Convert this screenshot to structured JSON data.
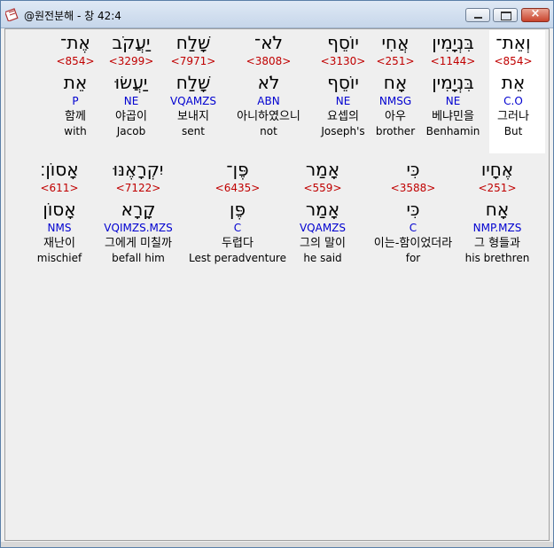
{
  "window": {
    "title": "@원전분해 - 창 42:4",
    "app_icon": "book-icon",
    "close_glyph": "×"
  },
  "rows": [
    [
      {
        "heb": "וְאֵת־",
        "num": "<854>",
        "lemma": "אֵת",
        "parse": "C.O",
        "kor": "그러나",
        "eng": "But",
        "selected": true
      },
      {
        "heb": "בִּנְיָמִין",
        "num": "<1144>",
        "lemma": "בִּנְיָמִין",
        "parse": "NE",
        "kor": "베냐민을",
        "eng": "Benhamin"
      },
      {
        "heb": "אֲחִי",
        "num": "<251>",
        "lemma": "אָח",
        "parse": "NMSG",
        "kor": "아우",
        "eng": "brother"
      },
      {
        "heb": "יוֹסֵף",
        "num": "<3130>",
        "lemma": "יוֹסֵף",
        "parse": "NE",
        "kor": "요셉의",
        "eng": "Joseph's"
      },
      {
        "heb": "לֹא־",
        "num": "<3808>",
        "lemma": "לֹא",
        "parse": "ABN",
        "kor": "아니하였으니",
        "eng": "not"
      },
      {
        "heb": "שָׁלַח",
        "num": "<7971>",
        "lemma": "שָׁלַח",
        "parse": "VQAMZS",
        "kor": "보내지",
        "eng": "sent"
      },
      {
        "heb": "יַעֲקֹב",
        "num": "<3299>",
        "lemma": "יַעֲשׂוּ",
        "parse": "NE",
        "kor": "야곱이",
        "eng": "Jacob"
      },
      {
        "heb": "אֶת־",
        "num": "<854>",
        "lemma": "אֵת",
        "parse": "P",
        "kor": "함께",
        "eng": "with"
      }
    ],
    [
      {
        "heb": "אֶחָיו",
        "num": "<251>",
        "lemma": "אָח",
        "parse": "NMP.MZS",
        "kor": "그 형들과",
        "eng": "his brethren"
      },
      {
        "heb": "כִּי",
        "num": "<3588>",
        "lemma": "כִּי",
        "parse": "C",
        "kor": "이는-함이었더라",
        "eng": "for"
      },
      {
        "heb": "אָמַר",
        "num": "<559>",
        "lemma": "אָמַר",
        "parse": "VQAMZS",
        "kor": "그의 말이",
        "eng": "he said"
      },
      {
        "heb": "פֶּן־",
        "num": "<6435>",
        "lemma": "פֶּן",
        "parse": "C",
        "kor": "두렵다",
        "eng": "Lest peradventure"
      },
      {
        "heb": "יִקְרָאֶנּוּ",
        "num": "<7122>",
        "lemma": "קָרָא",
        "parse": "VQIMZS.MZS",
        "kor": "그에게 미칠까",
        "eng": "befall him"
      },
      {
        "heb": "אָסוֹן׃",
        "num": "<611>",
        "lemma": "אָסוֹן",
        "parse": "NMS",
        "kor": "재난이",
        "eng": "mischief"
      }
    ]
  ]
}
